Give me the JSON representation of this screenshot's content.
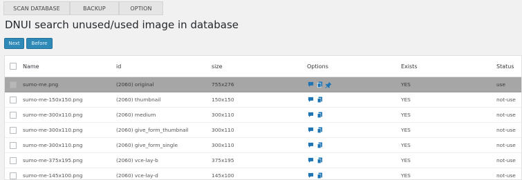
{
  "tabs": [
    {
      "label": "SCAN DATABASE"
    },
    {
      "label": "BACKUP"
    },
    {
      "label": "OPTION"
    }
  ],
  "page_title": "DNUI search unused/used image in database",
  "buttons": {
    "next": "Next",
    "before": "Before"
  },
  "table": {
    "headers": {
      "name": "Name",
      "id": "id",
      "size": "size",
      "options": "Options",
      "exists": "Exists",
      "status": "Status"
    },
    "rows": [
      {
        "name": "sumo-me.png",
        "id": "(2060) original",
        "size": "755x276",
        "exists": "YES",
        "status": "use",
        "selected": true,
        "options": [
          "comment-icon",
          "copy-icon",
          "pin-icon"
        ]
      },
      {
        "name": "sumo-me-150x150.png",
        "id": "(2060) thumbnail",
        "size": "150x150",
        "exists": "YES",
        "status": "not-use",
        "options": [
          "comment-icon",
          "copy-icon"
        ]
      },
      {
        "name": "sumo-me-300x110.png",
        "id": "(2060) medium",
        "size": "300x110",
        "exists": "YES",
        "status": "not-use",
        "options": [
          "comment-icon",
          "copy-icon"
        ]
      },
      {
        "name": "sumo-me-300x110.png",
        "id": "(2060) give_form_thumbnail",
        "size": "300x110",
        "exists": "YES",
        "status": "not-use",
        "options": [
          "comment-icon",
          "copy-icon"
        ]
      },
      {
        "name": "sumo-me-300x110.png",
        "id": "(2060) give_form_single",
        "size": "300x110",
        "exists": "YES",
        "status": "not-use",
        "options": [
          "comment-icon",
          "copy-icon"
        ]
      },
      {
        "name": "sumo-me-375x195.png",
        "id": "(2060) vce-lay-b",
        "size": "375x195",
        "exists": "YES",
        "status": "not-use",
        "options": [
          "comment-icon",
          "copy-icon"
        ]
      },
      {
        "name": "sumo-me-145x100.png",
        "id": "(2060) vce-lay-d",
        "size": "145x100",
        "exists": "YES",
        "status": "not-use",
        "options": [
          "comment-icon",
          "copy-icon"
        ]
      }
    ]
  },
  "colors": {
    "accent": "#2f8ab8",
    "icon": "#1f75b4",
    "selected_row": "#a6a6a6"
  }
}
